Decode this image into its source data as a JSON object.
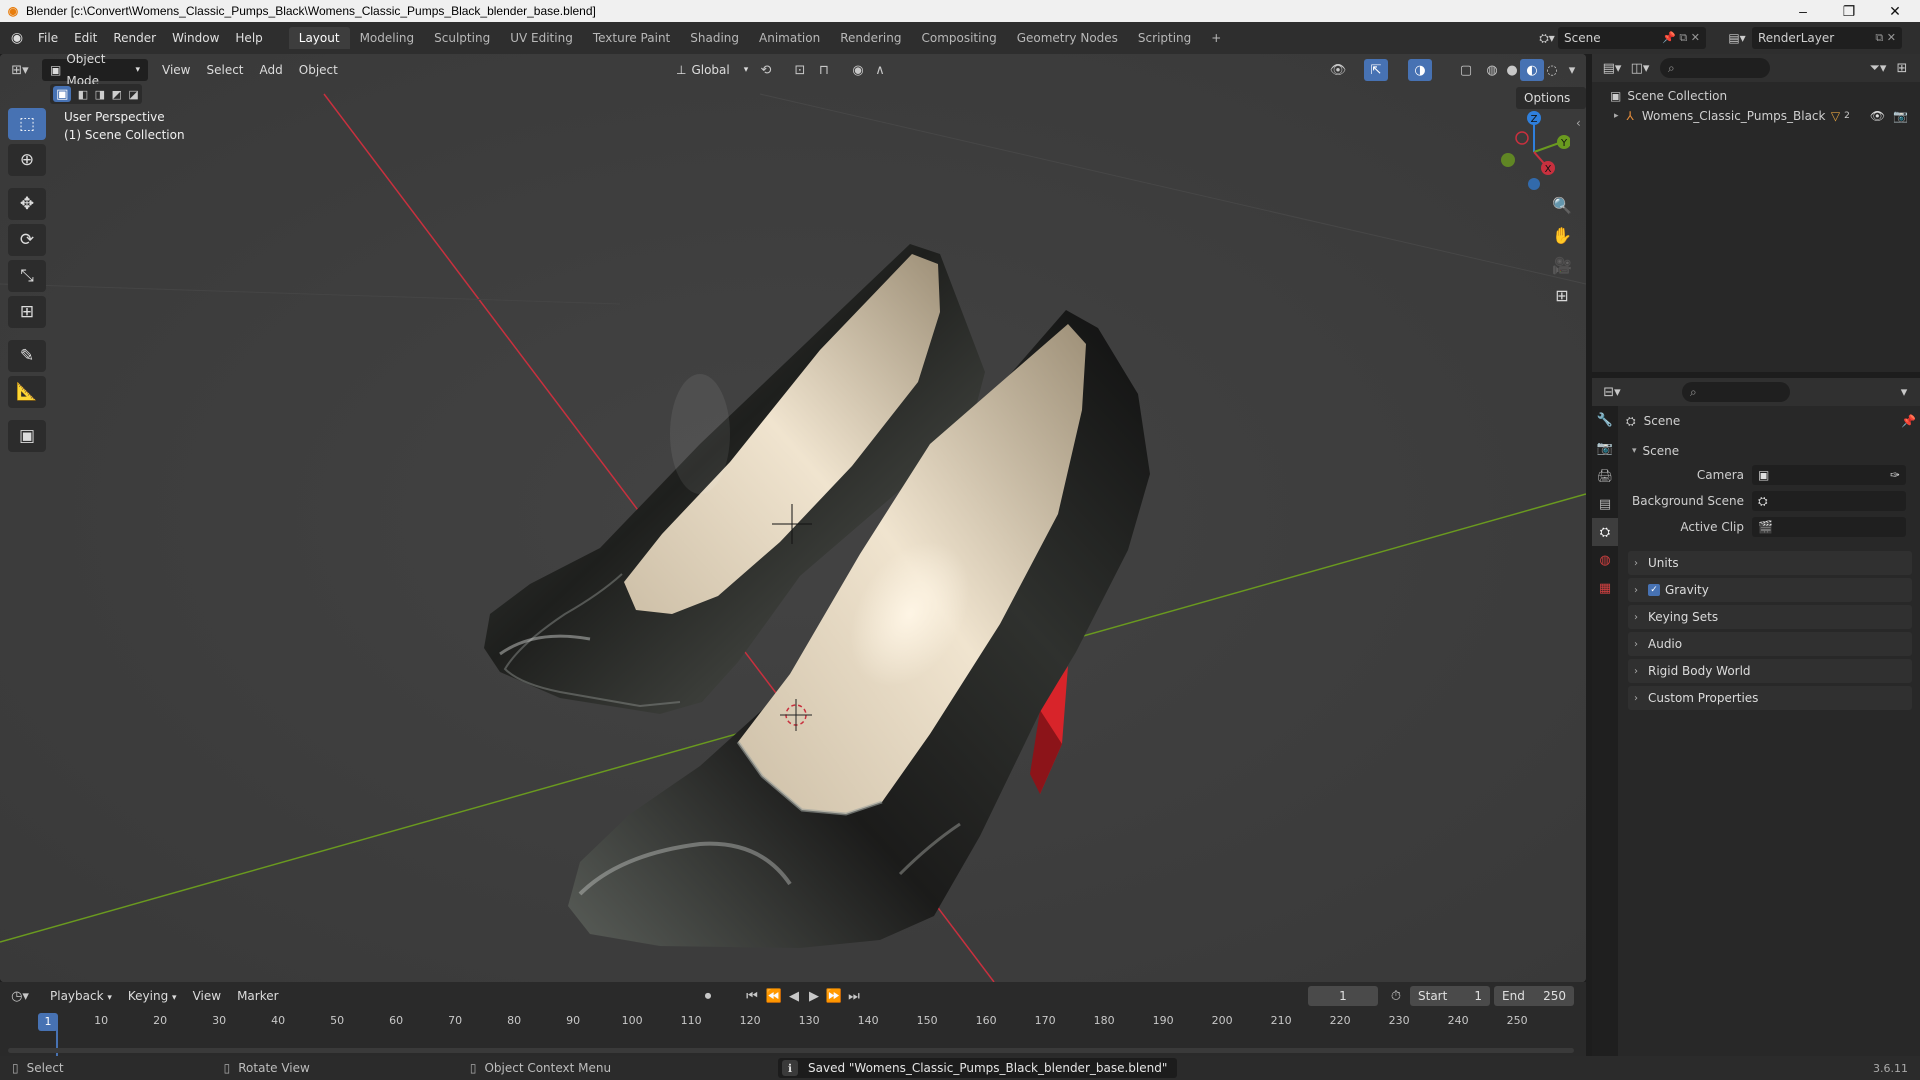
{
  "window": {
    "title": "Blender [c:\\Convert\\Womens_Classic_Pumps_Black\\Womens_Classic_Pumps_Black_blender_base.blend]",
    "controls": [
      "–",
      "❐",
      "✕"
    ]
  },
  "menubar": {
    "menus": [
      "File",
      "Edit",
      "Render",
      "Window",
      "Help"
    ],
    "workspaces": [
      "Layout",
      "Modeling",
      "Sculpting",
      "UV Editing",
      "Texture Paint",
      "Shading",
      "Animation",
      "Rendering",
      "Compositing",
      "Geometry Nodes",
      "Scripting"
    ],
    "active_workspace": "Layout",
    "add_tab": "+",
    "scene_name": "Scene",
    "view_layer": "RenderLayer"
  },
  "viewport": {
    "mode": "Object Mode",
    "menus": [
      "View",
      "Select",
      "Add",
      "Object"
    ],
    "orientation": "Global",
    "options_label": "Options",
    "info_line1": "User Perspective",
    "info_line2": "(1) Scene Collection",
    "gizmo_axes": {
      "x": "X",
      "y": "Y",
      "z": "Z"
    },
    "colors": {
      "background": "#3e3e3e",
      "x_axis": "#c8303e",
      "y_axis": "#6a9a1f",
      "z_axis": "#2f7fdc"
    }
  },
  "outliner": {
    "root": "Scene Collection",
    "items": [
      {
        "name": "Womens_Classic_Pumps_Black",
        "mesh_count": "2"
      }
    ]
  },
  "properties": {
    "header_title": "Scene",
    "section": "Scene",
    "fields": {
      "camera": "Camera",
      "background_scene": "Background Scene",
      "active_clip": "Active Clip"
    },
    "panels": [
      "Units",
      "Gravity",
      "Keying Sets",
      "Audio",
      "Rigid Body World",
      "Custom Properties"
    ],
    "gravity_checked": true
  },
  "timeline": {
    "menus": [
      "Playback",
      "Keying",
      "View",
      "Marker"
    ],
    "current_frame": "1",
    "start_label": "Start",
    "start": "1",
    "end_label": "End",
    "end": "250",
    "ticks": [
      "10",
      "20",
      "30",
      "40",
      "50",
      "60",
      "70",
      "80",
      "90",
      "100",
      "110",
      "120",
      "130",
      "140",
      "150",
      "160",
      "170",
      "180",
      "190",
      "200",
      "210",
      "220",
      "230",
      "240",
      "250"
    ],
    "playhead_label": "1"
  },
  "statusbar": {
    "select": "Select",
    "rotate": "Rotate View",
    "context": "Object Context Menu",
    "message": "Saved \"Womens_Classic_Pumps_Black_blender_base.blend\"",
    "version": "3.6.11"
  }
}
